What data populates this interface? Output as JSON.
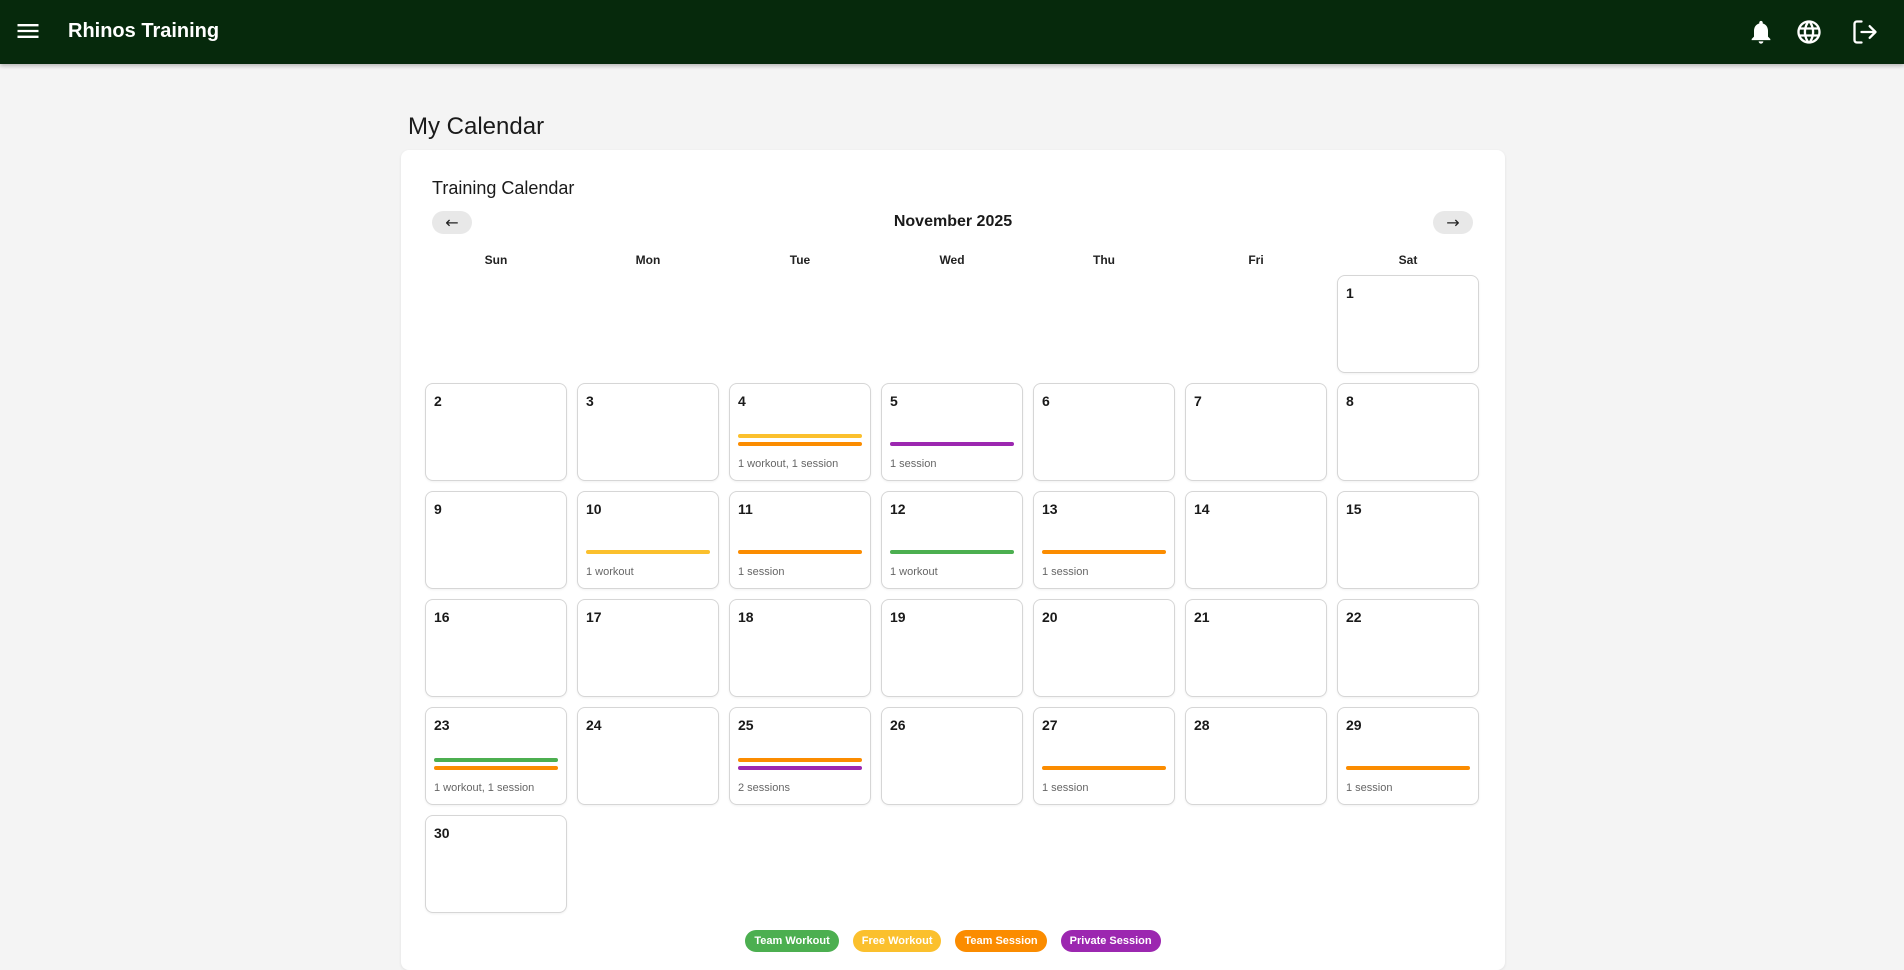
{
  "app": {
    "title": "Rhinos Training"
  },
  "header_icons": [
    "menu-icon",
    "bell-icon",
    "globe-icon",
    "logout-icon"
  ],
  "page": {
    "title": "My Calendar"
  },
  "calendar": {
    "card_title": "Training Calendar",
    "month_label": "November 2025",
    "prev_label": "←",
    "next_label": "→",
    "weekdays": [
      "Sun",
      "Mon",
      "Tue",
      "Wed",
      "Thu",
      "Fri",
      "Sat"
    ],
    "first_weekday_index": 6,
    "days_in_month": 30,
    "colors": {
      "team_workout": "#4caf50",
      "free_workout": "#fbc02d",
      "team_session": "#fb8c00",
      "private_session": "#9c27b0"
    },
    "events": {
      "4": {
        "bars": [
          "free_workout",
          "team_session"
        ],
        "summary": "1 workout, 1 session"
      },
      "5": {
        "bars": [
          "private_session"
        ],
        "summary": "1 session"
      },
      "10": {
        "bars": [
          "free_workout"
        ],
        "summary": "1 workout"
      },
      "11": {
        "bars": [
          "team_session"
        ],
        "summary": "1 session"
      },
      "12": {
        "bars": [
          "team_workout"
        ],
        "summary": "1 workout"
      },
      "13": {
        "bars": [
          "team_session"
        ],
        "summary": "1 session"
      },
      "23": {
        "bars": [
          "team_workout",
          "team_session"
        ],
        "summary": "1 workout, 1 session"
      },
      "25": {
        "bars": [
          "team_session",
          "private_session"
        ],
        "summary": "2 sessions"
      },
      "27": {
        "bars": [
          "team_session"
        ],
        "summary": "1 session"
      },
      "29": {
        "bars": [
          "team_session"
        ],
        "summary": "1 session"
      }
    },
    "legend": [
      {
        "key": "team_workout",
        "label": "Team Workout"
      },
      {
        "key": "free_workout",
        "label": "Free Workout"
      },
      {
        "key": "team_session",
        "label": "Team Session"
      },
      {
        "key": "private_session",
        "label": "Private Session"
      }
    ]
  }
}
